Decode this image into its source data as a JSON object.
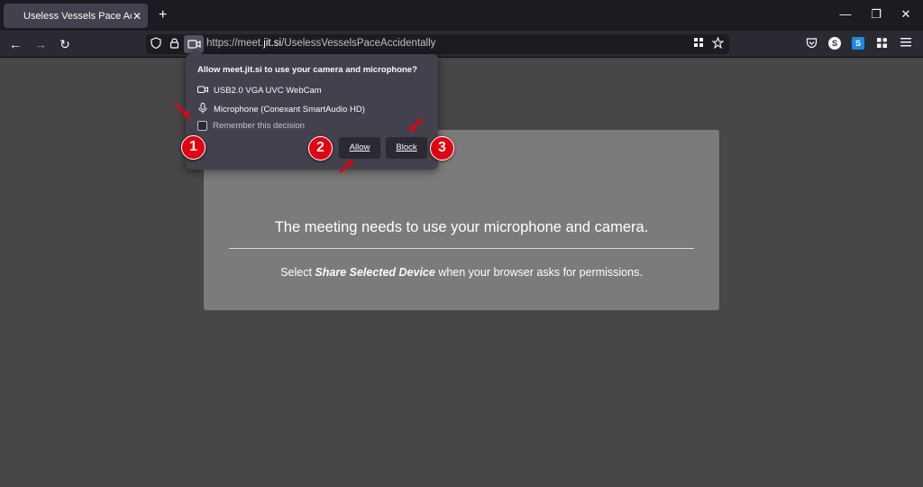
{
  "tab": {
    "title": "Useless Vessels Pace Accidentally",
    "close": "✕",
    "new_tab": "+"
  },
  "window_controls": {
    "minimize": "—",
    "restore": "❐",
    "close": "✕"
  },
  "nav": {
    "back": "←",
    "forward": "→",
    "reload": "↻"
  },
  "url": {
    "prefix": "https://meet.",
    "domain": "jit.si",
    "path": "/UselessVesselsPaceAccidentally"
  },
  "popup": {
    "question": "Allow meet.jit.si to use your camera and microphone?",
    "camera": "USB2.0 VGA UVC WebCam",
    "microphone": "Microphone (Conexant SmartAudio HD)",
    "remember": "Remember this decision",
    "allow": "Allow",
    "block": "Block"
  },
  "page": {
    "title": "The meeting needs to use your microphone and camera.",
    "sub_prefix": "Select ",
    "sub_emphasis": "Share Selected Device",
    "sub_suffix": " when your browser asks for permissions."
  },
  "badges": [
    "1",
    "2",
    "3"
  ],
  "colors": {
    "badge": "#e3000f",
    "page_bg": "#474747",
    "card_bg": "#7b7b7b",
    "popup_bg": "#42414d"
  }
}
